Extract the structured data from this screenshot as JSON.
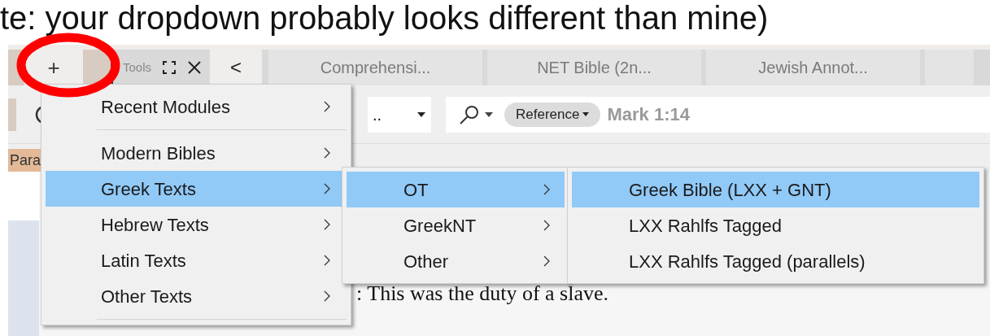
{
  "caption": "te: your dropdown probably looks different than mine)",
  "tab_bar": {
    "add_button": "+",
    "tools_label": "Tools",
    "back_button": "<",
    "tabs": [
      {
        "label": "Comprehensi...",
        "selected": false
      },
      {
        "label": "NET Bible (2n...",
        "selected": false
      },
      {
        "label": "Jewish Annot...",
        "selected": false
      }
    ]
  },
  "toolbar": {
    "dropdown_value": "..",
    "search": {
      "filter": "Reference",
      "value": "Mark 1:14"
    }
  },
  "tag": "Para",
  "content_text": ": This was the duty of a slave.",
  "menus": [
    {
      "items": [
        {
          "kind": "item",
          "label": "Recent Modules",
          "selected": false,
          "has_submenu": true
        },
        {
          "kind": "separator"
        },
        {
          "kind": "item",
          "label": "Modern Bibles",
          "selected": false,
          "has_submenu": true
        },
        {
          "kind": "item",
          "label": "Greek Texts",
          "selected": true,
          "has_submenu": true
        },
        {
          "kind": "item",
          "label": "Hebrew Texts",
          "selected": false,
          "has_submenu": true
        },
        {
          "kind": "item",
          "label": "Latin Texts",
          "selected": false,
          "has_submenu": true
        },
        {
          "kind": "item",
          "label": "Other Texts",
          "selected": false,
          "has_submenu": true
        },
        {
          "kind": "separator"
        }
      ]
    },
    {
      "items": [
        {
          "kind": "item",
          "label": "OT",
          "selected": true,
          "has_submenu": true
        },
        {
          "kind": "item",
          "label": "GreekNT",
          "selected": false,
          "has_submenu": true
        },
        {
          "kind": "item",
          "label": "Other",
          "selected": false,
          "has_submenu": true
        }
      ]
    },
    {
      "items": [
        {
          "kind": "item",
          "label": "Greek Bible (LXX + GNT)",
          "selected": true,
          "has_submenu": false
        },
        {
          "kind": "item",
          "label": "LXX Rahlfs Tagged",
          "selected": false,
          "has_submenu": false
        },
        {
          "kind": "item",
          "label": "LXX Rahlfs Tagged (parallels)",
          "selected": false,
          "has_submenu": false
        }
      ]
    }
  ]
}
